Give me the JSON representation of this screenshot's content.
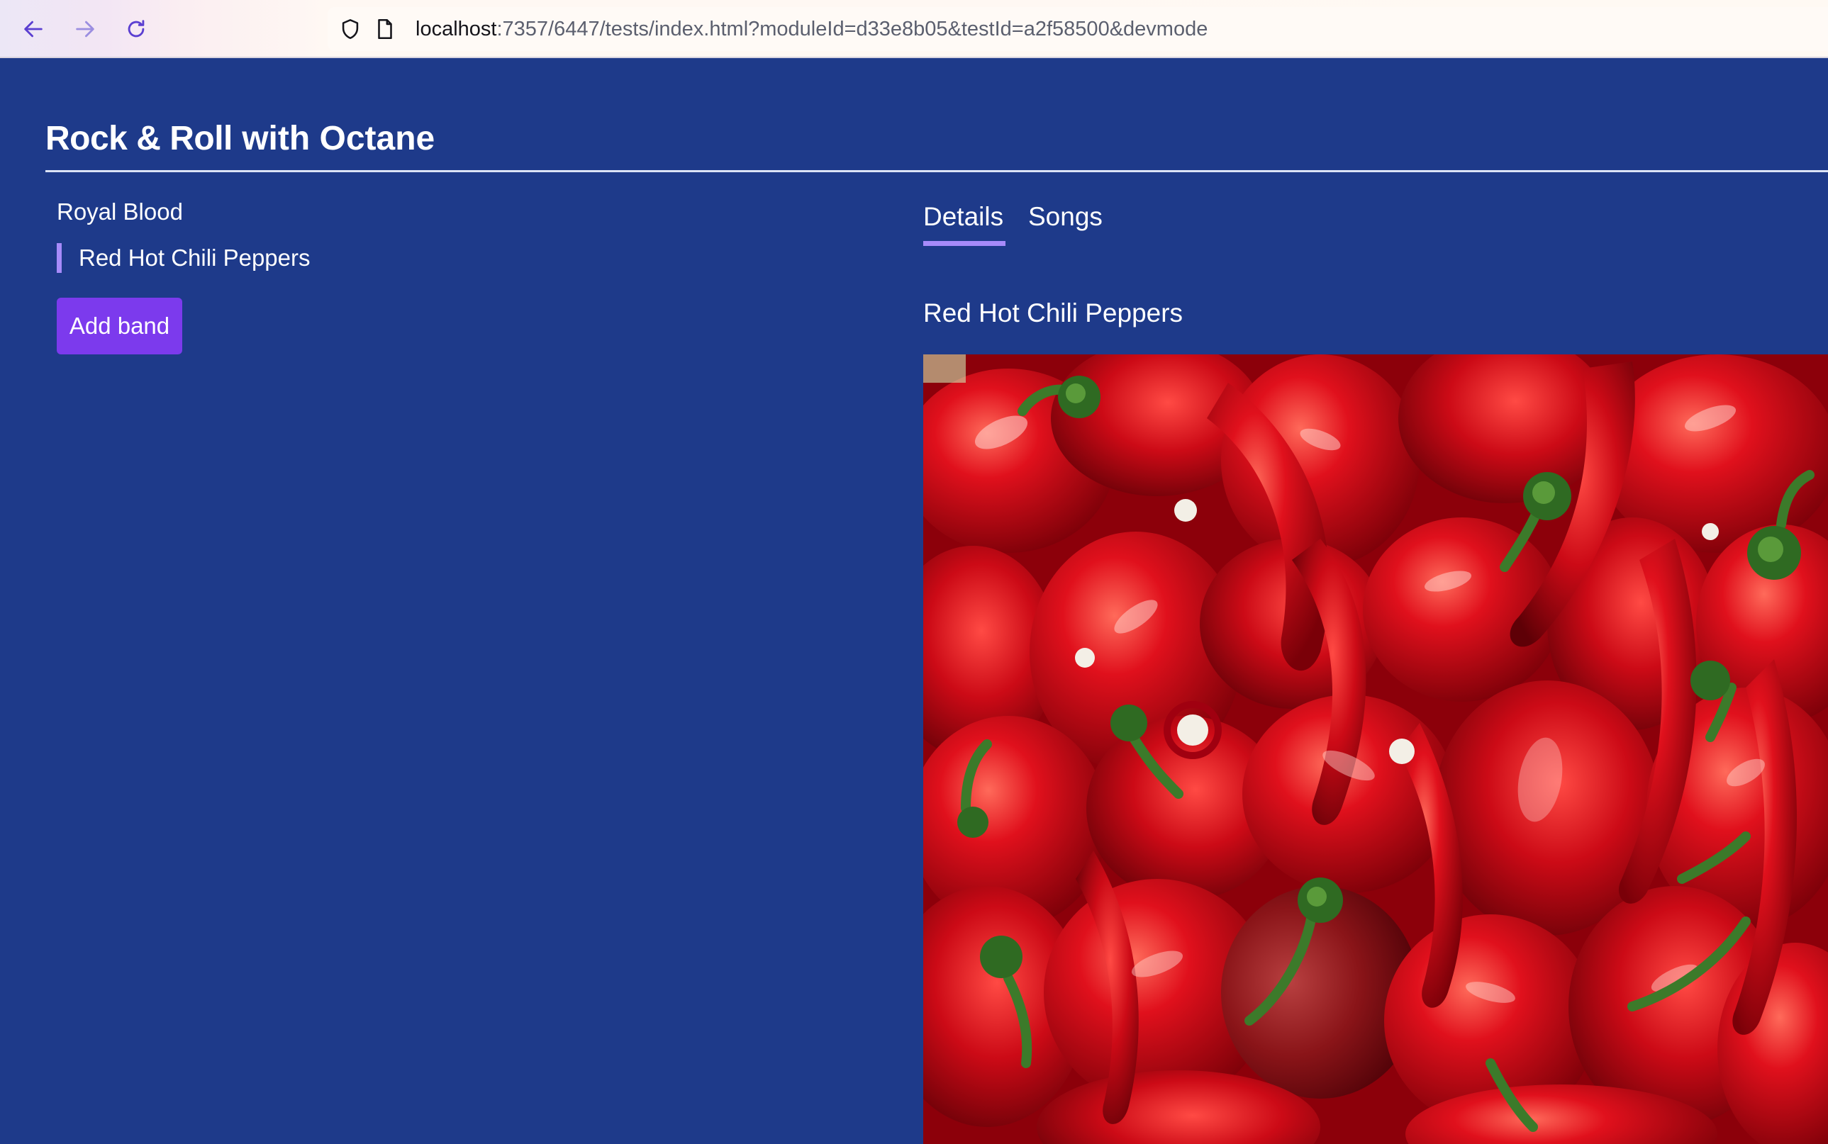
{
  "browser": {
    "url_host": "localhost",
    "url_rest": ":7357/6447/tests/index.html?moduleId=d33e8b05&testId=a2f58500&devmode",
    "back_icon": "arrow-left-icon",
    "forward_icon": "arrow-right-icon",
    "reload_icon": "reload-icon",
    "shield_icon": "shield-icon",
    "page_icon": "page-icon"
  },
  "app": {
    "title_strong": "Rock & Roll",
    "title_rest": " with Octane"
  },
  "bands": [
    {
      "name": "Royal Blood",
      "active": false
    },
    {
      "name": "Red Hot Chili Peppers",
      "active": true
    }
  ],
  "add_band_label": "Add band",
  "tabs": [
    {
      "label": "Details",
      "active": true
    },
    {
      "label": "Songs",
      "active": false
    }
  ],
  "detail": {
    "band_name": "Red Hot Chili Peppers"
  },
  "colors": {
    "background": "#1e3a8a",
    "accent": "#a78bfa",
    "button": "#7c3aed",
    "text": "#ffffff"
  }
}
